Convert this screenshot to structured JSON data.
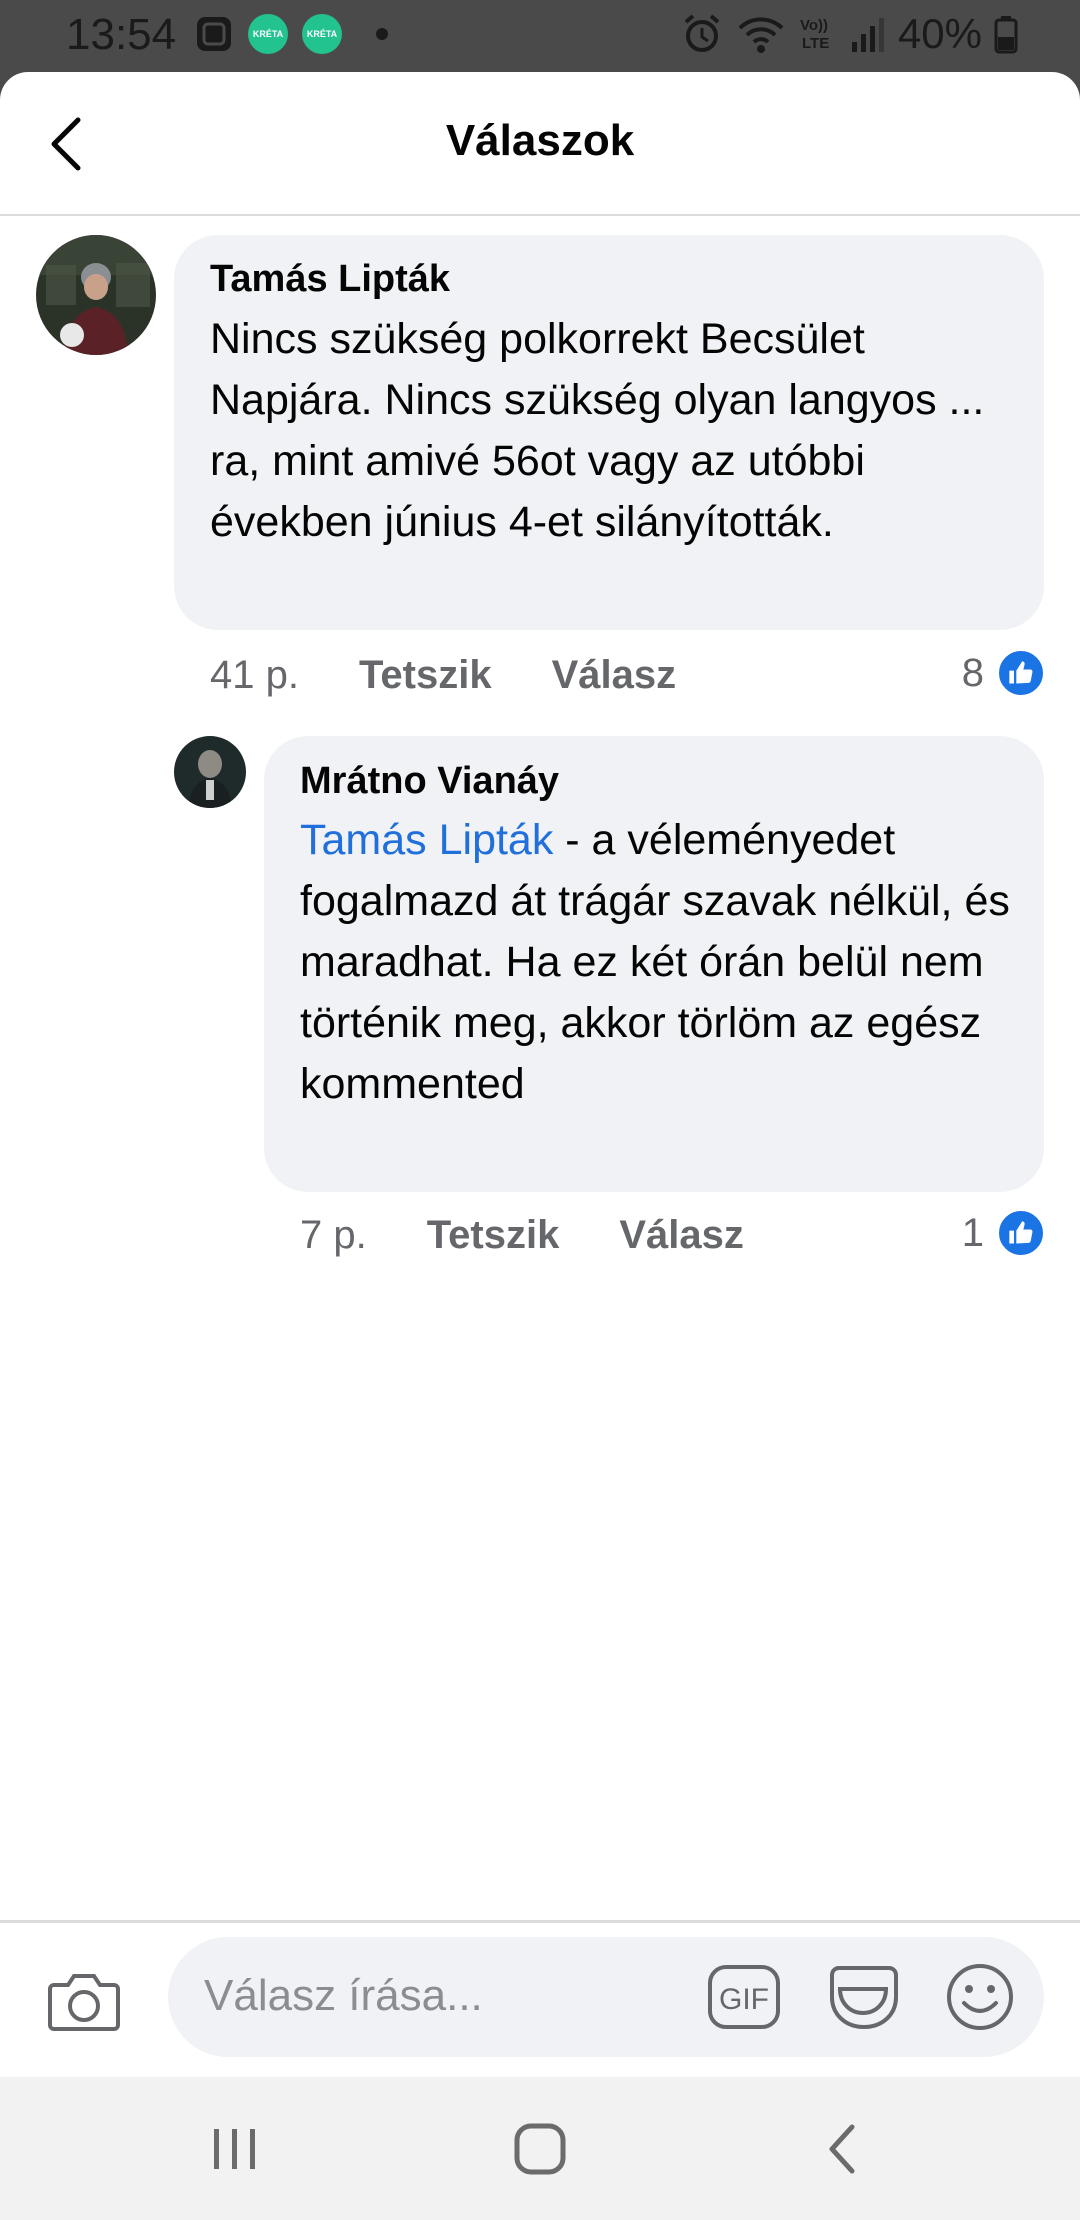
{
  "status_bar": {
    "time": "13:54",
    "kreta_label": "KRÉTA",
    "battery": "40%",
    "icons": [
      "screenshot-icon",
      "kreta-app-icon",
      "kreta-app-icon",
      "notification-dot",
      "alarm-icon",
      "wifi-icon",
      "volte-icon",
      "signal-icon",
      "battery-icon"
    ]
  },
  "header": {
    "title": "Válaszok",
    "back_icon": "back-arrow-icon"
  },
  "comments": [
    {
      "author": "Tamás Lipták",
      "text": "Nincs szükség polkorrekt Becsület Napjára. Nincs szükség olyan langyos ... ra, mint amivé 56ot vagy az utóbbi években június 4-et silányították.",
      "time": "41 p.",
      "like_label": "Tetszik",
      "reply_label": "Válasz",
      "reaction_count": "8"
    },
    {
      "author": "Mrátno Vianáy",
      "mention": "Tamás Lipták",
      "text": " - a véleményedet fogalmazd át trágár szavak nélkül, és maradhat. Ha ez két órán belül nem történik meg, akkor törlöm az egész kommented",
      "time": "7 p.",
      "like_label": "Tetszik",
      "reply_label": "Válasz",
      "reaction_count": "1"
    }
  ],
  "composer": {
    "placeholder": "Válasz írása...",
    "gif_label": "GIF",
    "icons": [
      "camera-icon",
      "gif-icon",
      "sticker-icon",
      "emoji-icon"
    ]
  },
  "navbar": {
    "icons": [
      "recent-apps-icon",
      "home-icon",
      "back-icon"
    ]
  },
  "colors": {
    "accent": "#1b74e4",
    "mention": "#216fdb",
    "bubble": "#f0f2f5",
    "secondary_text": "#65676b"
  }
}
